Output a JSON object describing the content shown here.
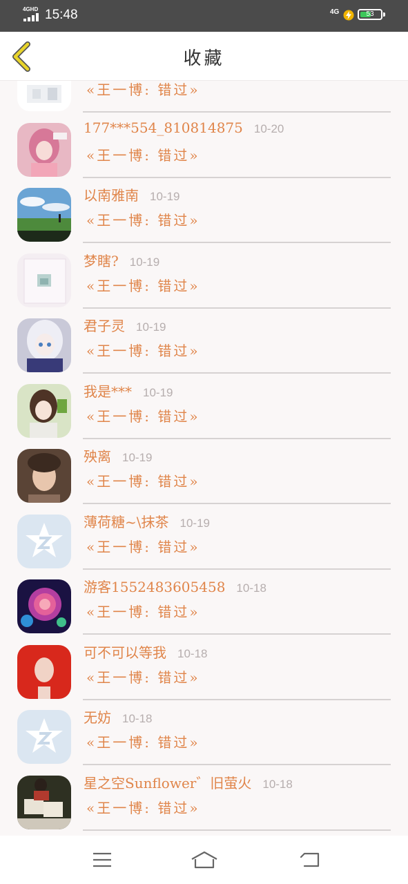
{
  "status_bar": {
    "network": "4GHD",
    "time": "15:48",
    "network_right": "4G",
    "battery": "53",
    "battery_level": 0.53
  },
  "header": {
    "title": "收藏"
  },
  "list": {
    "first_message": "«王一博: 错过»",
    "items": [
      {
        "name": "177***554_810814875",
        "date": "10-20",
        "message": "«王一博: 错过»",
        "avatar": "pink-hair-avatar"
      },
      {
        "name": "以南雅南",
        "date": "10-19",
        "message": "«王一博: 错过»",
        "avatar": "sky-field-avatar"
      },
      {
        "name": "梦瞎?",
        "date": "10-19",
        "message": "«王一博: 错过»",
        "avatar": "framed-picture-avatar"
      },
      {
        "name": "君子灵",
        "date": "10-19",
        "message": "«王一博: 错过»",
        "avatar": "white-hair-avatar"
      },
      {
        "name": "我是***",
        "date": "10-19",
        "message": "«王一博: 错过»",
        "avatar": "anime-girl-avatar"
      },
      {
        "name": "殃离",
        "date": "10-19",
        "message": "«王一博: 错过»",
        "avatar": "portrait-avatar"
      },
      {
        "name": "薄荷糖~\\抹茶",
        "date": "10-19",
        "message": "«王一博: 错过»",
        "avatar": "default-qzone-avatar"
      },
      {
        "name": "游客1552483605458",
        "date": "10-18",
        "message": "«王一博: 错过»",
        "avatar": "galaxy-rose-avatar"
      },
      {
        "name": "可不可以等我",
        "date": "10-18",
        "message": "«王一博: 错过»",
        "avatar": "red-hair-avatar"
      },
      {
        "name": "无妨",
        "date": "10-18",
        "message": "«王一博: 错过»",
        "avatar": "default-qzone-avatar"
      },
      {
        "name": "星之空Sunflower゛旧萤火",
        "date": "10-18",
        "message": "«王一博: 错过»",
        "avatar": "photo-avatar"
      }
    ]
  },
  "nav": {
    "menu_icon": "menu-icon",
    "home_icon": "home-icon",
    "back_icon": "back-arrow-icon"
  },
  "colors": {
    "accent": "#e0854a",
    "date": "#b6aeae",
    "status_bar": "#4b4b4b",
    "back_arrow": "#e8d42a"
  }
}
